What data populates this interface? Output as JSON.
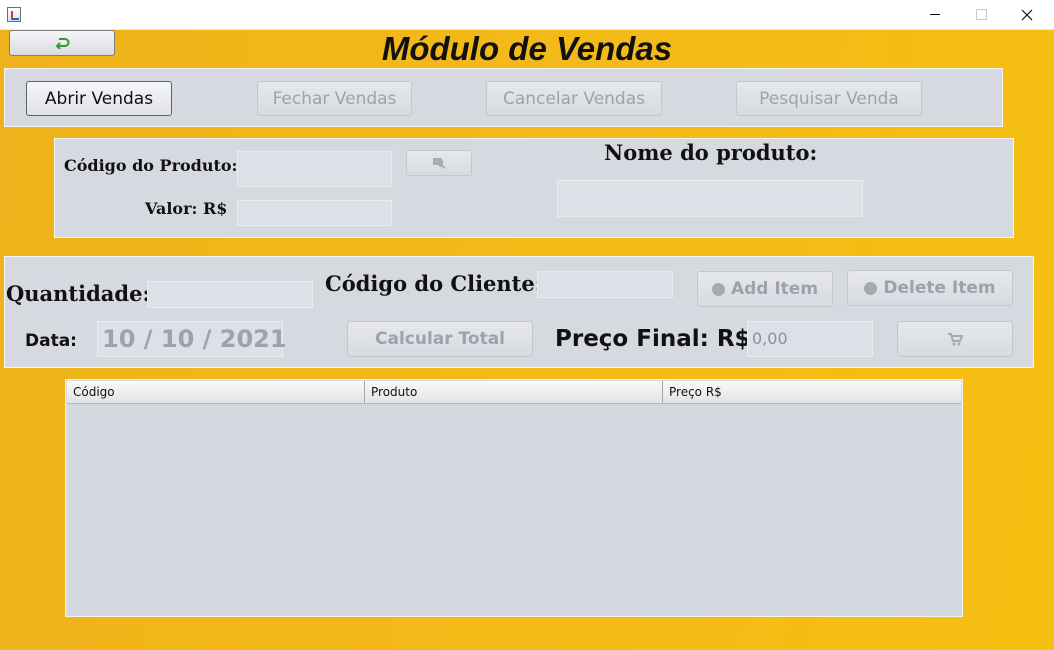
{
  "window": {
    "icon": "java-app-icon",
    "controls": {
      "minimize": "minimize-icon",
      "maximize": "maximize-icon",
      "close": "close-icon"
    }
  },
  "back_button": {
    "icon": "green-return-arrow-icon"
  },
  "title": "Módulo de Vendas",
  "actions": {
    "open": "Abrir Vendas",
    "close": "Fechar Vendas",
    "cancel": "Cancelar Vendas",
    "search": "Pesquisar Venda"
  },
  "product": {
    "code_label": "Código do Produto:",
    "code_value": "",
    "search_icon": "search-icon",
    "value_label": "Valor: R$",
    "value_value": "",
    "name_label": "Nome do produto:",
    "name_value": ""
  },
  "sale": {
    "quantity_label": "Quantidade:",
    "quantity_value": "",
    "client_label": "Código do Cliente:",
    "client_value": "",
    "add_item": "Add Item",
    "delete_item": "Delete Item",
    "date_label": "Data:",
    "date_value": "10 / 10 / 2021",
    "calc_total": "Calcular Total",
    "final_price_label": "Preço Final: R$",
    "final_price_value": "0,00",
    "cart_icon": "cart-icon"
  },
  "table": {
    "columns": [
      "Código",
      "Produto",
      "Preço R$"
    ],
    "rows": []
  },
  "colors": {
    "background": "#f3b918",
    "panel": "#d7d9e0",
    "disabled_text": "#9ea2aa"
  }
}
